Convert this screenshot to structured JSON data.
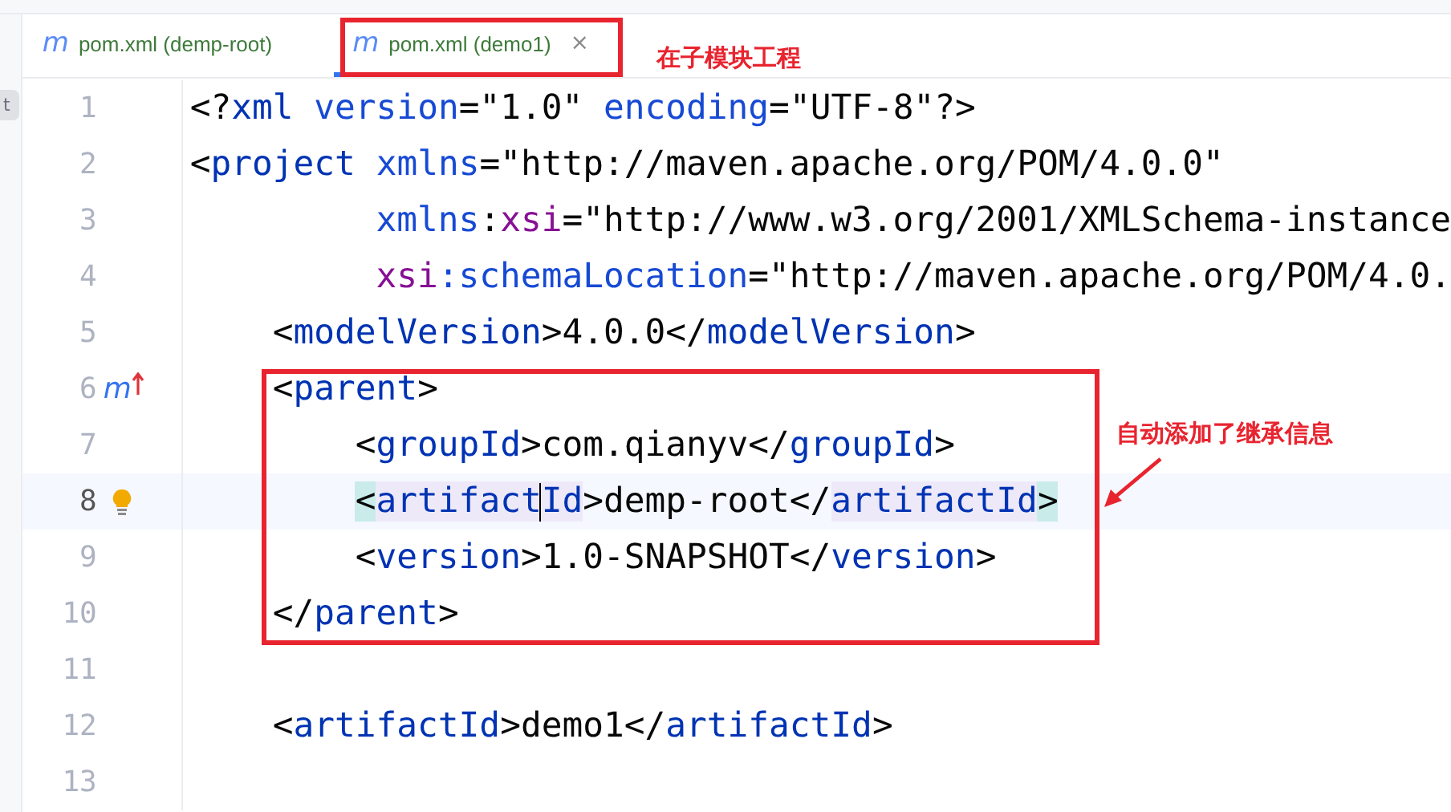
{
  "side_strip": {
    "button": "t"
  },
  "tabs": [
    {
      "icon": "m",
      "label": "pom.xml (demp-root)",
      "selected": false
    },
    {
      "icon": "m",
      "label": "pom.xml (demo1)",
      "selected": true,
      "close": "×"
    }
  ],
  "editor": {
    "lines": [
      {
        "number": "1",
        "current": false,
        "tokens": [
          {
            "text": "<?",
            "kind": "punct"
          },
          {
            "text": "xml",
            "kind": "tag"
          },
          {
            "text": " version",
            "kind": "attr"
          },
          {
            "text": "=",
            "kind": "punct"
          },
          {
            "text": "\"1.0\"",
            "kind": "string"
          },
          {
            "text": " encoding",
            "kind": "attr"
          },
          {
            "text": "=",
            "kind": "punct"
          },
          {
            "text": "\"UTF-8\"",
            "kind": "string"
          },
          {
            "text": "?>",
            "kind": "punct"
          }
        ]
      },
      {
        "number": "2",
        "current": false,
        "tokens": [
          {
            "text": "<",
            "kind": "punct"
          },
          {
            "text": "project",
            "kind": "tag"
          },
          {
            "text": " xmlns",
            "kind": "attr"
          },
          {
            "text": "=",
            "kind": "punct"
          },
          {
            "text": "\"http://maven.apache.org/POM/4.0.0\"",
            "kind": "string"
          }
        ]
      },
      {
        "number": "3",
        "current": false,
        "tokens": [
          {
            "text": "         xmlns",
            "kind": "attr"
          },
          {
            "text": ":",
            "kind": "punct"
          },
          {
            "text": "xsi",
            "kind": "ns"
          },
          {
            "text": "=",
            "kind": "punct"
          },
          {
            "text": "\"http://www.w3.org/2001/XMLSchema-instance",
            "kind": "string"
          }
        ]
      },
      {
        "number": "4",
        "current": false,
        "tokens": [
          {
            "text": "         xsi",
            "kind": "ns"
          },
          {
            "text": ":schemaLocation",
            "kind": "attr"
          },
          {
            "text": "=",
            "kind": "punct"
          },
          {
            "text": "\"http://maven.apache.org/POM/4.0.",
            "kind": "string"
          }
        ]
      },
      {
        "number": "5",
        "current": false,
        "tokens": [
          {
            "text": "    <",
            "kind": "punct"
          },
          {
            "text": "modelVersion",
            "kind": "tag"
          },
          {
            "text": ">",
            "kind": "punct"
          },
          {
            "text": "4.0.0",
            "kind": "text"
          },
          {
            "text": "</",
            "kind": "punct"
          },
          {
            "text": "modelVersion",
            "kind": "tag"
          },
          {
            "text": ">",
            "kind": "punct"
          }
        ]
      },
      {
        "number": "6",
        "current": false,
        "marker": "m",
        "tokens": [
          {
            "text": "    <",
            "kind": "punct"
          },
          {
            "text": "parent",
            "kind": "tag"
          },
          {
            "text": ">",
            "kind": "punct"
          }
        ]
      },
      {
        "number": "7",
        "current": false,
        "tokens": [
          {
            "text": "        <",
            "kind": "punct"
          },
          {
            "text": "groupId",
            "kind": "tag"
          },
          {
            "text": ">",
            "kind": "punct"
          },
          {
            "text": "com.qianyv",
            "kind": "text"
          },
          {
            "text": "</",
            "kind": "punct"
          },
          {
            "text": "groupId",
            "kind": "tag"
          },
          {
            "text": ">",
            "kind": "punct"
          }
        ]
      },
      {
        "number": "8",
        "current": true,
        "bulb": true,
        "tokens": [
          {
            "text": "        <",
            "kind": "punct",
            "matched": true
          },
          {
            "text": "artifact",
            "kind": "tag",
            "matched": true
          },
          {
            "text": "Id",
            "kind": "tag",
            "matched": true,
            "caret_before": true
          },
          {
            "text": ">",
            "kind": "punct",
            "matched": false
          },
          {
            "text": "demp-root",
            "kind": "text",
            "matched": false
          },
          {
            "text": "</",
            "kind": "punct",
            "matched": false
          },
          {
            "text": "artifactId",
            "kind": "tag",
            "matched": true
          },
          {
            "text": ">",
            "kind": "punct",
            "matched": true
          }
        ]
      },
      {
        "number": "9",
        "current": false,
        "tokens": [
          {
            "text": "        <",
            "kind": "punct"
          },
          {
            "text": "version",
            "kind": "tag"
          },
          {
            "text": ">",
            "kind": "punct"
          },
          {
            "text": "1.0-SNAPSHOT",
            "kind": "text"
          },
          {
            "text": "</",
            "kind": "punct"
          },
          {
            "text": "version",
            "kind": "tag"
          },
          {
            "text": ">",
            "kind": "punct"
          }
        ]
      },
      {
        "number": "10",
        "current": false,
        "tokens": [
          {
            "text": "    </",
            "kind": "punct"
          },
          {
            "text": "parent",
            "kind": "tag"
          },
          {
            "text": ">",
            "kind": "punct"
          }
        ]
      },
      {
        "number": "11",
        "current": false
      },
      {
        "number": "12",
        "current": false,
        "tokens": [
          {
            "text": "    <",
            "kind": "punct"
          },
          {
            "text": "artifactId",
            "kind": "tag"
          },
          {
            "text": ">",
            "kind": "punct"
          },
          {
            "text": "demo1",
            "kind": "text"
          },
          {
            "text": "</",
            "kind": "punct"
          },
          {
            "text": "artifactId",
            "kind": "tag"
          },
          {
            "text": ">",
            "kind": "punct"
          }
        ]
      },
      {
        "number": "13",
        "current": false
      }
    ]
  },
  "annotations": {
    "tab_note": "在子模块工程",
    "block_note": "自动添加了继承信息"
  }
}
